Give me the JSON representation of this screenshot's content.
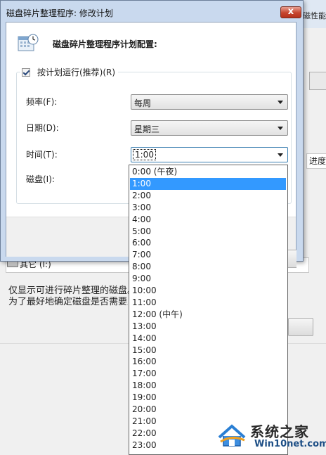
{
  "background_window": {
    "right_label": "磁性能",
    "progress_label": "进度",
    "drive_label": "其它 (I:)",
    "info_line1": "仅显示可进行碎片整理的磁盘。",
    "info_line2": "为了最好地确定磁盘是否需要立即"
  },
  "dialog": {
    "title": "磁盘碎片整理程序: 修改计划",
    "close_glyph": "x",
    "heading": "磁盘碎片整理程序计划配置:",
    "run_on_schedule": {
      "label": "按计划运行(推荐)(R)",
      "checked": true
    },
    "frequency": {
      "label": "频率(F):",
      "value": "每周"
    },
    "day": {
      "label": "日期(D):",
      "value": "星期三"
    },
    "time": {
      "label": "时间(T):",
      "value": "1:00"
    },
    "disks": {
      "label": "磁盘(I):"
    }
  },
  "time_dropdown": {
    "selected_index": 1,
    "options": [
      "0:00 (午夜)",
      "1:00",
      "2:00",
      "3:00",
      "4:00",
      "5:00",
      "6:00",
      "7:00",
      "8:00",
      "9:00",
      "10:00",
      "11:00",
      "12:00 (中午)",
      "13:00",
      "14:00",
      "15:00",
      "16:00",
      "17:00",
      "18:00",
      "19:00",
      "20:00",
      "21:00",
      "22:00",
      "23:00"
    ]
  },
  "watermark": {
    "title": "系统之家",
    "subtitle": "Win10net.com"
  }
}
